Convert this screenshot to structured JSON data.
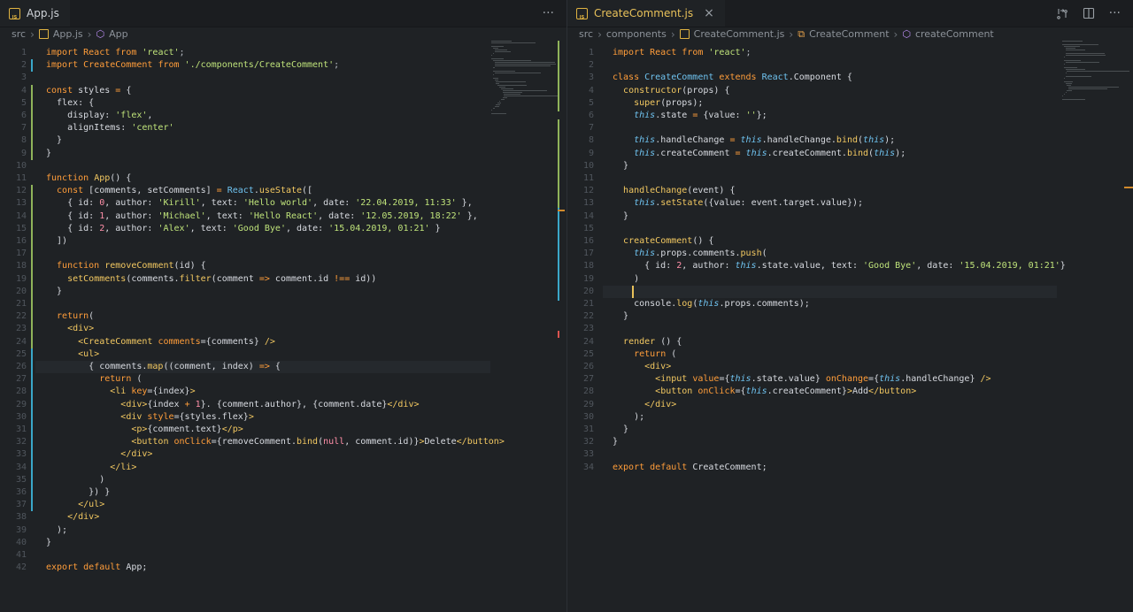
{
  "left": {
    "tab": {
      "label": "App.js",
      "actions_label": "···"
    },
    "breadcrumb": [
      "src",
      "App.js",
      "App"
    ],
    "lines": [
      [
        [
          "import React ",
          "k"
        ],
        [
          "from ",
          "k"
        ],
        [
          "'react'",
          "s"
        ],
        [
          ";",
          "p"
        ]
      ],
      [
        [
          "import CreateComment ",
          "k"
        ],
        [
          "from ",
          "k"
        ],
        [
          "'./components/CreateComment'",
          "s"
        ],
        [
          ";",
          "p"
        ]
      ],
      [],
      [
        [
          "const ",
          "k"
        ],
        [
          "styles ",
          ""
        ],
        [
          "= ",
          "k"
        ],
        [
          "{",
          ""
        ]
      ],
      [
        [
          "  flex: {",
          ""
        ]
      ],
      [
        [
          "    display: ",
          ""
        ],
        [
          "'flex'",
          "s"
        ],
        [
          ",",
          ""
        ]
      ],
      [
        [
          "    alignItems: ",
          ""
        ],
        [
          "'center'",
          "s"
        ]
      ],
      [
        [
          "  }",
          ""
        ]
      ],
      [
        [
          "}",
          ""
        ]
      ],
      [],
      [
        [
          "function ",
          "k"
        ],
        [
          "App",
          "f"
        ],
        [
          "() {",
          ""
        ]
      ],
      [
        [
          "  const ",
          "k"
        ],
        [
          "[comments, setComments] ",
          ""
        ],
        [
          "= ",
          "k"
        ],
        [
          "React",
          "c"
        ],
        [
          ".",
          ""
        ],
        [
          "useState",
          "f"
        ],
        [
          "([",
          ""
        ]
      ],
      [
        [
          "    { id: ",
          ""
        ],
        [
          "0",
          "g"
        ],
        [
          ", author: ",
          ""
        ],
        [
          "'Kirill'",
          "s"
        ],
        [
          ", text: ",
          ""
        ],
        [
          "'Hello world'",
          "s"
        ],
        [
          ", date: ",
          ""
        ],
        [
          "'22.04.2019, 11:33'",
          "s"
        ],
        [
          " },",
          ""
        ]
      ],
      [
        [
          "    { id: ",
          ""
        ],
        [
          "1",
          "g"
        ],
        [
          ", author: ",
          ""
        ],
        [
          "'Michael'",
          "s"
        ],
        [
          ", text: ",
          ""
        ],
        [
          "'Hello React'",
          "s"
        ],
        [
          ", date: ",
          ""
        ],
        [
          "'12.05.2019, 18:22'",
          "s"
        ],
        [
          " },",
          ""
        ]
      ],
      [
        [
          "    { id: ",
          ""
        ],
        [
          "2",
          "g"
        ],
        [
          ", author: ",
          ""
        ],
        [
          "'Alex'",
          "s"
        ],
        [
          ", text: ",
          ""
        ],
        [
          "'Good Bye'",
          "s"
        ],
        [
          ", date: ",
          ""
        ],
        [
          "'15.04.2019, 01:21'",
          "s"
        ],
        [
          " }",
          ""
        ]
      ],
      [
        [
          "  ])",
          ""
        ]
      ],
      [],
      [
        [
          "  function ",
          "k"
        ],
        [
          "removeComment",
          "f"
        ],
        [
          "(id) {",
          ""
        ]
      ],
      [
        [
          "    ",
          ""
        ],
        [
          "setComments",
          "f"
        ],
        [
          "(comments.",
          ""
        ],
        [
          "filter",
          "f"
        ],
        [
          "(comment ",
          ""
        ],
        [
          "=> ",
          "k"
        ],
        [
          "comment.id ",
          ""
        ],
        [
          "!== ",
          "k"
        ],
        [
          "id))",
          ""
        ]
      ],
      [
        [
          "  }",
          ""
        ]
      ],
      [],
      [
        [
          "  return",
          "k"
        ],
        [
          "(",
          ""
        ]
      ],
      [
        [
          "    ",
          ""
        ],
        [
          "<div>",
          "t"
        ]
      ],
      [
        [
          "      ",
          ""
        ],
        [
          "<CreateComment ",
          "t"
        ],
        [
          "comments",
          "k"
        ],
        [
          "={comments} ",
          ""
        ],
        [
          "/>",
          "t"
        ]
      ],
      [
        [
          "      ",
          ""
        ],
        [
          "<ul>",
          "t"
        ]
      ],
      [
        [
          "        { comments.",
          ""
        ],
        [
          "map",
          "f"
        ],
        [
          "((comment, index) ",
          ""
        ],
        [
          "=> ",
          "k"
        ],
        [
          "{",
          ""
        ]
      ],
      [
        [
          "          ",
          ""
        ],
        [
          "return ",
          "k"
        ],
        [
          "(",
          ""
        ]
      ],
      [
        [
          "            ",
          ""
        ],
        [
          "<li ",
          "t"
        ],
        [
          "key",
          "k"
        ],
        [
          "={index}",
          ""
        ],
        [
          ">",
          "t"
        ]
      ],
      [
        [
          "              ",
          ""
        ],
        [
          "<div>",
          "t"
        ],
        [
          "{index ",
          ""
        ],
        [
          "+ ",
          "k"
        ],
        [
          "1",
          "g"
        ],
        [
          "}. {comment.author}, {comment.date}",
          ""
        ],
        [
          "</div>",
          "t"
        ]
      ],
      [
        [
          "              ",
          ""
        ],
        [
          "<div ",
          "t"
        ],
        [
          "style",
          "k"
        ],
        [
          "={styles.flex}",
          ""
        ],
        [
          ">",
          "t"
        ]
      ],
      [
        [
          "                ",
          ""
        ],
        [
          "<p>",
          "t"
        ],
        [
          "{comment.text}",
          ""
        ],
        [
          "</p>",
          "t"
        ]
      ],
      [
        [
          "                ",
          ""
        ],
        [
          "<button ",
          "t"
        ],
        [
          "onClick",
          "k"
        ],
        [
          "={removeComment.",
          ""
        ],
        [
          "bind",
          "f"
        ],
        [
          "(",
          ""
        ],
        [
          "null",
          "g"
        ],
        [
          ", comment.id)}",
          ""
        ],
        [
          ">",
          "t"
        ],
        [
          "Delete",
          ""
        ],
        [
          "</button>",
          "t"
        ]
      ],
      [
        [
          "              ",
          ""
        ],
        [
          "</div>",
          "t"
        ]
      ],
      [
        [
          "            ",
          ""
        ],
        [
          "</li>",
          "t"
        ]
      ],
      [
        [
          "          )",
          ""
        ]
      ],
      [
        [
          "        }) }",
          ""
        ]
      ],
      [
        [
          "      ",
          ""
        ],
        [
          "</ul>",
          "t"
        ]
      ],
      [
        [
          "    ",
          ""
        ],
        [
          "</div>",
          "t"
        ]
      ],
      [
        [
          "  );",
          ""
        ]
      ],
      [
        [
          "}",
          ""
        ]
      ],
      [],
      [
        [
          "export ",
          "k"
        ],
        [
          "default ",
          "k"
        ],
        [
          "App;",
          ""
        ]
      ]
    ]
  },
  "right": {
    "tab": {
      "label": "CreateComment.js",
      "close": "×"
    },
    "breadcrumb": [
      "src",
      "components",
      "CreateComment.js",
      "CreateComment",
      "createComment"
    ],
    "lines": [
      [
        [
          "import React ",
          "k"
        ],
        [
          "from ",
          "k"
        ],
        [
          "'react'",
          "s"
        ],
        [
          ";",
          "p"
        ]
      ],
      [],
      [
        [
          "class ",
          "k"
        ],
        [
          "CreateComment ",
          "c"
        ],
        [
          "extends ",
          "k"
        ],
        [
          "React",
          "c"
        ],
        [
          ".Component {",
          ""
        ]
      ],
      [
        [
          "  ",
          ""
        ],
        [
          "constructor",
          "f"
        ],
        [
          "(props) {",
          ""
        ]
      ],
      [
        [
          "    ",
          ""
        ],
        [
          "super",
          "f"
        ],
        [
          "(props);",
          ""
        ]
      ],
      [
        [
          "    ",
          ""
        ],
        [
          "this",
          "i"
        ],
        [
          ".state ",
          ""
        ],
        [
          "= ",
          "k"
        ],
        [
          "{value: ",
          ""
        ],
        [
          "''",
          "s"
        ],
        [
          "};",
          ""
        ]
      ],
      [],
      [
        [
          "    ",
          ""
        ],
        [
          "this",
          "i"
        ],
        [
          ".handleChange ",
          ""
        ],
        [
          "= ",
          "k"
        ],
        [
          "this",
          "i"
        ],
        [
          ".handleChange.",
          ""
        ],
        [
          "bind",
          "f"
        ],
        [
          "(",
          ""
        ],
        [
          "this",
          "i"
        ],
        [
          ");",
          ""
        ]
      ],
      [
        [
          "    ",
          ""
        ],
        [
          "this",
          "i"
        ],
        [
          ".createComment ",
          ""
        ],
        [
          "= ",
          "k"
        ],
        [
          "this",
          "i"
        ],
        [
          ".createComment.",
          ""
        ],
        [
          "bind",
          "f"
        ],
        [
          "(",
          ""
        ],
        [
          "this",
          "i"
        ],
        [
          ");",
          ""
        ]
      ],
      [
        [
          "  }",
          ""
        ]
      ],
      [],
      [
        [
          "  ",
          ""
        ],
        [
          "handleChange",
          "f"
        ],
        [
          "(event) {",
          ""
        ]
      ],
      [
        [
          "    ",
          ""
        ],
        [
          "this",
          "i"
        ],
        [
          ".",
          ""
        ],
        [
          "setState",
          "f"
        ],
        [
          "({value: event.target.value});",
          ""
        ]
      ],
      [
        [
          "  }",
          ""
        ]
      ],
      [],
      [
        [
          "  ",
          ""
        ],
        [
          "createComment",
          "f"
        ],
        [
          "() {",
          ""
        ]
      ],
      [
        [
          "    ",
          ""
        ],
        [
          "this",
          "i"
        ],
        [
          ".props.comments.",
          ""
        ],
        [
          "push",
          "f"
        ],
        [
          "(",
          ""
        ]
      ],
      [
        [
          "      { id: ",
          ""
        ],
        [
          "2",
          "g"
        ],
        [
          ", author: ",
          ""
        ],
        [
          "this",
          "i"
        ],
        [
          ".state.value, text: ",
          ""
        ],
        [
          "'Good Bye'",
          "s"
        ],
        [
          ", date: ",
          ""
        ],
        [
          "'15.04.2019, 01:21'",
          "s"
        ],
        [
          "}",
          ""
        ]
      ],
      [
        [
          "    )",
          ""
        ]
      ],
      [
        [
          "    ",
          ""
        ]
      ],
      [
        [
          "    console.",
          ""
        ],
        [
          "log",
          "f"
        ],
        [
          "(",
          ""
        ],
        [
          "this",
          "i"
        ],
        [
          ".props.comments);",
          ""
        ]
      ],
      [
        [
          "  }",
          ""
        ]
      ],
      [],
      [
        [
          "  ",
          ""
        ],
        [
          "render ",
          "f"
        ],
        [
          "() {",
          ""
        ]
      ],
      [
        [
          "    ",
          ""
        ],
        [
          "return ",
          "k"
        ],
        [
          "(",
          ""
        ]
      ],
      [
        [
          "      ",
          ""
        ],
        [
          "<div>",
          "t"
        ]
      ],
      [
        [
          "        ",
          ""
        ],
        [
          "<input ",
          "t"
        ],
        [
          "value",
          "k"
        ],
        [
          "={",
          ""
        ],
        [
          "this",
          "i"
        ],
        [
          ".state.value} ",
          ""
        ],
        [
          "onChange",
          "k"
        ],
        [
          "={",
          ""
        ],
        [
          "this",
          "i"
        ],
        [
          ".handleChange} ",
          ""
        ],
        [
          "/>",
          "t"
        ]
      ],
      [
        [
          "        ",
          ""
        ],
        [
          "<button ",
          "t"
        ],
        [
          "onClick",
          "k"
        ],
        [
          "={",
          ""
        ],
        [
          "this",
          "i"
        ],
        [
          ".createComment}",
          ""
        ],
        [
          ">",
          "t"
        ],
        [
          "Add",
          ""
        ],
        [
          "</button>",
          "t"
        ]
      ],
      [
        [
          "      ",
          ""
        ],
        [
          "</div>",
          "t"
        ]
      ],
      [
        [
          "    );",
          ""
        ]
      ],
      [
        [
          "  }",
          ""
        ]
      ],
      [
        [
          "}",
          ""
        ]
      ],
      [],
      [
        [
          "export ",
          "k"
        ],
        [
          "default ",
          "k"
        ],
        [
          "CreateComment;",
          ""
        ]
      ]
    ]
  }
}
